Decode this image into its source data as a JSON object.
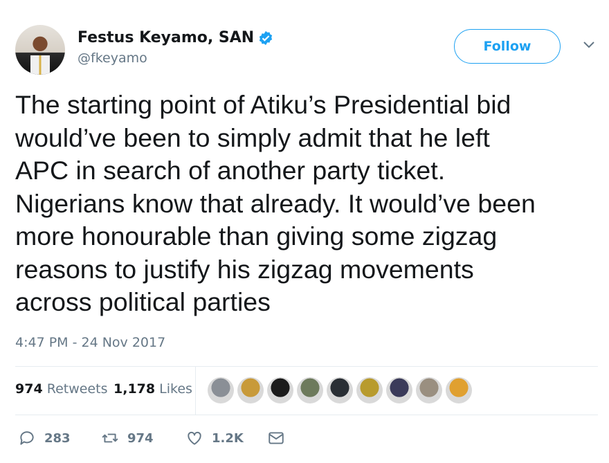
{
  "author": {
    "name": "Festus Keyamo, SAN",
    "handle": "@fkeyamo",
    "verified_icon": "verified-badge-icon",
    "avatar_icon": "profile-photo"
  },
  "follow_button": {
    "label": "Follow"
  },
  "menu_icon": "chevron-down-icon",
  "tweet": {
    "text": "The starting point of Atiku’s Presidential bid\nwould’ve been to simply admit that he left\nAPC in search of another party ticket.\nNigerians know that already. It would’ve been\nmore honourable than giving some zigzag\nreasons to justify his zigzag movements\nacross political parties",
    "timestamp": "4:47 PM - 24 Nov 2017"
  },
  "stats": {
    "retweets_count": "974",
    "retweets_label": "Retweets",
    "likes_count": "1,178",
    "likes_label": "Likes"
  },
  "likers": [
    {
      "color": "#8a8f96"
    },
    {
      "color": "#c89a3a"
    },
    {
      "color": "#1b1b1b"
    },
    {
      "color": "#6d7a5c"
    },
    {
      "color": "#2a2f35"
    },
    {
      "color": "#b89b2e"
    },
    {
      "color": "#3b3b5a"
    },
    {
      "color": "#9a8f80"
    },
    {
      "color": "#e0a030"
    }
  ],
  "actions": {
    "reply_count": "283",
    "retweet_count": "974",
    "like_count": "1.2K"
  },
  "colors": {
    "accent": "#1da1f2",
    "text": "#14171a",
    "secondary": "#657786",
    "divider": "#e6ecf0"
  }
}
